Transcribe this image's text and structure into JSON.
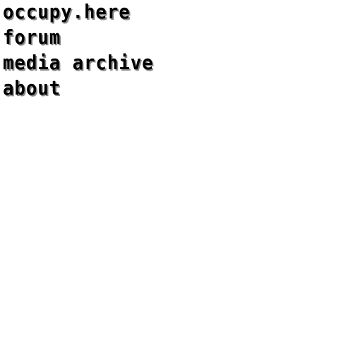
{
  "nav": {
    "items": [
      {
        "label": "occupy.here"
      },
      {
        "label": "forum"
      },
      {
        "label": "media archive"
      },
      {
        "label": "about"
      }
    ]
  },
  "colors": {
    "background": "#ffffff",
    "text": "#000000",
    "shadow": "#8a8a8a"
  }
}
